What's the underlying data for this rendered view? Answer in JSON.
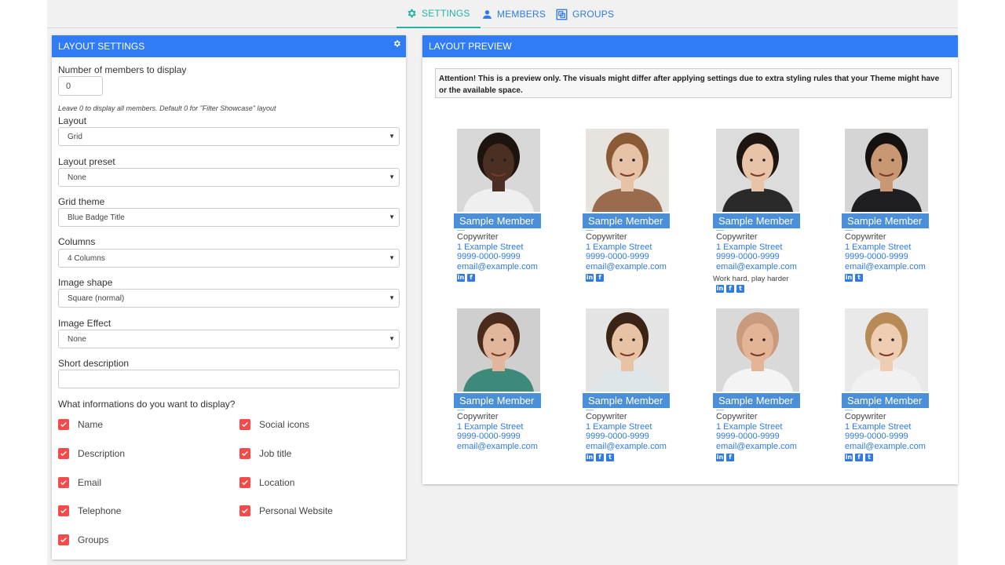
{
  "nav": {
    "tabs": [
      {
        "label": "SETTINGS",
        "icon": "gear-icon",
        "active": true
      },
      {
        "label": "MEMBERS",
        "icon": "user-icon",
        "active": false
      },
      {
        "label": "GROUPS",
        "icon": "groups-icon",
        "active": false
      }
    ]
  },
  "settings": {
    "title": "LAYOUT SETTINGS",
    "members_to_display": {
      "label": "Number of members to display",
      "value": "0",
      "hint": "Leave 0 to display all members. Default 0 for \"Filter Showcase\" layout"
    },
    "layout": {
      "label": "Layout",
      "value": "Grid"
    },
    "layout_preset": {
      "label": "Layout preset",
      "value": "None"
    },
    "grid_theme": {
      "label": "Grid theme",
      "value": "Blue Badge Title"
    },
    "columns": {
      "label": "Columns",
      "value": "4 Columns"
    },
    "image_shape": {
      "label": "Image shape",
      "value": "Square (normal)"
    },
    "image_effect": {
      "label": "Image Effect",
      "value": "None"
    },
    "short_description": {
      "label": "Short description",
      "value": ""
    },
    "display_question": "What informations do you want to display?",
    "options": [
      {
        "label": "Name",
        "checked": true
      },
      {
        "label": "Social icons",
        "checked": true
      },
      {
        "label": "Description",
        "checked": true
      },
      {
        "label": "Job title",
        "checked": true
      },
      {
        "label": "Email",
        "checked": true
      },
      {
        "label": "Location",
        "checked": true
      },
      {
        "label": "Telephone",
        "checked": true
      },
      {
        "label": "Personal Website",
        "checked": true
      },
      {
        "label": "Groups",
        "checked": true
      }
    ]
  },
  "preview": {
    "title": "LAYOUT PREVIEW",
    "attention": "Attention! This is a preview only. The visuals might differ after applying settings due to extra styling rules that your Theme might have or the available space.",
    "members": [
      {
        "name": "Sample Member",
        "job": "Copywriter",
        "address": "1 Example Street",
        "phone": "9999-0000-9999",
        "email": "email@example.com",
        "description": "",
        "socials": [
          "linkedin-icon",
          "facebook-icon"
        ],
        "photo_bg": "#d8d8d8",
        "skin": "#4a2f22",
        "hair": "#1d1410",
        "shirt": "#efefef"
      },
      {
        "name": "Sample Member",
        "job": "Copywriter",
        "address": "1 Example Street",
        "phone": "9999-0000-9999",
        "email": "email@example.com",
        "description": "",
        "socials": [
          "linkedin-icon",
          "facebook-icon"
        ],
        "photo_bg": "#e7e3de",
        "skin": "#e6c2a6",
        "hair": "#8a5a36",
        "shirt": "#9a6b4c"
      },
      {
        "name": "Sample Member",
        "job": "Copywriter",
        "address": "1 Example Street",
        "phone": "9999-0000-9999",
        "email": "email@example.com",
        "description": "Work hard, play harder",
        "socials": [
          "linkedin-icon",
          "facebook-icon",
          "twitter-icon"
        ],
        "photo_bg": "#dcdcdc",
        "skin": "#e9c3a8",
        "hair": "#1e1511",
        "shirt": "#2a2a2a"
      },
      {
        "name": "Sample Member",
        "job": "Copywriter",
        "address": "1 Example Street",
        "phone": "9999-0000-9999",
        "email": "email@example.com",
        "description": "",
        "socials": [
          "linkedin-icon",
          "twitter-icon"
        ],
        "photo_bg": "#d5d5d5",
        "skin": "#c99873",
        "hair": "#15110e",
        "shirt": "#1f1f22"
      },
      {
        "name": "Sample Member",
        "job": "Copywriter",
        "address": "1 Example Street",
        "phone": "9999-0000-9999",
        "email": "email@example.com",
        "description": "",
        "socials": [],
        "photo_bg": "#cfcfcf",
        "skin": "#e2b69a",
        "hair": "#4a2a1a",
        "shirt": "#3d8a7a"
      },
      {
        "name": "Sample Member",
        "job": "Copywriter",
        "address": "1 Example Street",
        "phone": "9999-0000-9999",
        "email": "email@example.com",
        "description": "",
        "socials": [
          "linkedin-icon",
          "facebook-icon",
          "twitter-icon"
        ],
        "photo_bg": "#e4e4e4",
        "skin": "#e8c2a4",
        "hair": "#3b2416",
        "shirt": "#dfe6ea"
      },
      {
        "name": "Sample Member",
        "job": "Copywriter",
        "address": "1 Example Street",
        "phone": "9999-0000-9999",
        "email": "email@example.com",
        "description": "",
        "socials": [
          "linkedin-icon",
          "facebook-icon"
        ],
        "photo_bg": "#d9d9d9",
        "skin": "#e4b497",
        "hair": "#c99a7d",
        "shirt": "#f4f4f4"
      },
      {
        "name": "Sample Member",
        "job": "Copywriter",
        "address": "1 Example Street",
        "phone": "9999-0000-9999",
        "email": "email@example.com",
        "description": "",
        "socials": [
          "linkedin-icon",
          "facebook-icon",
          "twitter-icon"
        ],
        "photo_bg": "#e9e9e9",
        "skin": "#efcdb2",
        "hair": "#b78a56",
        "shirt": "#f1f1f1"
      }
    ]
  },
  "colors": {
    "accent": "#2f7cf6",
    "active_tab": "#26b3a1",
    "badge": "#4a8fd8",
    "checkbox": "#f44a4a",
    "link": "#2f7ae5"
  }
}
